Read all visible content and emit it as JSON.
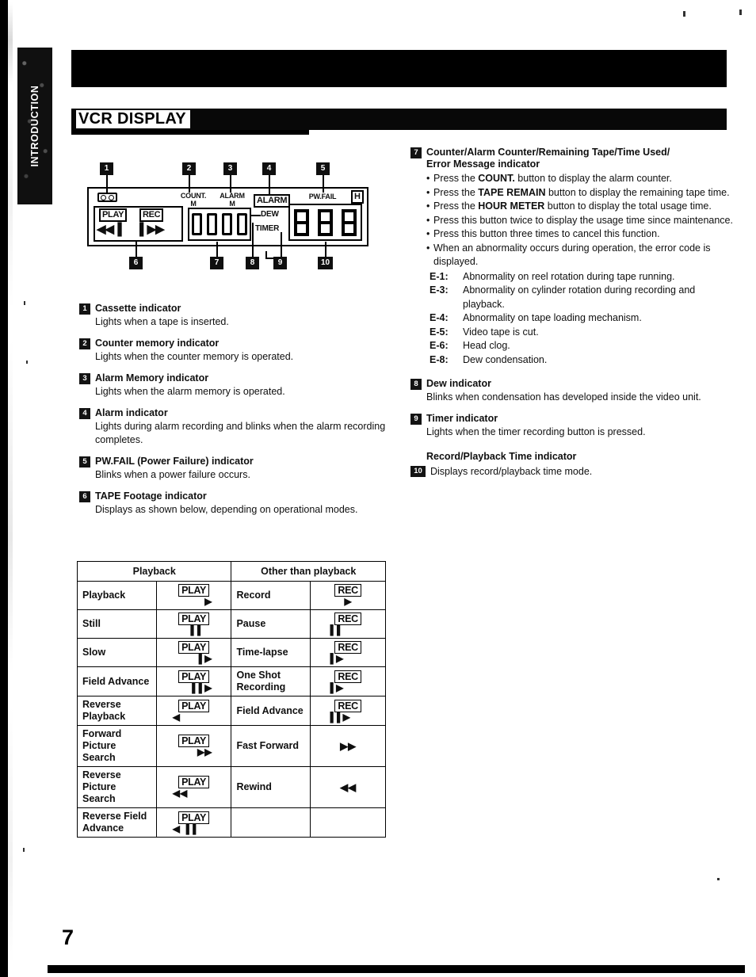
{
  "page": {
    "title": "VCR DISPLAY",
    "section_tab": "INTRODUCTION",
    "number": "7"
  },
  "diagram": {
    "name": "vcr-display-panel",
    "callouts_top": [
      "1",
      "2",
      "3",
      "4",
      "5"
    ],
    "callouts_bottom": [
      "6",
      "7",
      "8",
      "9",
      "10"
    ],
    "labels": {
      "count_m_line1": "COUNT.",
      "count_m_line2": "M",
      "alarm_m_line1": "ALARM",
      "alarm_m_line2": "M",
      "alarm_box": "ALARM",
      "pw_fail": "PW.FAIL",
      "hour": "H",
      "dew": "DEW",
      "timer": "TIMER",
      "play": "PLAY",
      "rec": "REC",
      "play_arrows": "◀◀▐",
      "rec_arrows": "▌▶▶",
      "counter_value": "0000",
      "hour_value": "888",
      "cassette_icon": "cassette-icon"
    }
  },
  "left_column": [
    {
      "num": "1",
      "head": "Cassette indicator",
      "body": "Lights when a tape is inserted."
    },
    {
      "num": "2",
      "head": "Counter memory indicator",
      "body": "Lights when the counter memory is operated."
    },
    {
      "num": "3",
      "head": "Alarm Memory indicator",
      "body": "Lights when the alarm memory is operated."
    },
    {
      "num": "4",
      "head": "Alarm indicator",
      "body": "Lights during alarm recording and blinks when the alarm recording completes."
    },
    {
      "num": "5",
      "head": "PW.FAIL (Power Failure) indicator",
      "body": "Blinks when a power failure occurs."
    },
    {
      "num": "6",
      "head": "TAPE Footage indicator",
      "body": "Displays as shown below, depending on operational modes."
    }
  ],
  "right_column": {
    "item7": {
      "num": "7",
      "head_line1": "Counter/Alarm Counter/Remaining Tape/Time Used/",
      "head_line2": "Error Message indicator",
      "bullets": [
        {
          "pre": "Press the ",
          "strong": "COUNT.",
          "post": " button to display the alarm counter."
        },
        {
          "pre": "Press the ",
          "strong": "TAPE REMAIN",
          "post": " button to display the remaining tape time."
        },
        {
          "pre": "Press the ",
          "strong": "HOUR METER",
          "post": " button to display the total usage time."
        },
        {
          "pre": "Press this button twice to display the usage time since maintenance.",
          "strong": "",
          "post": ""
        },
        {
          "pre": "Press this button three times to cancel this function.",
          "strong": "",
          "post": ""
        },
        {
          "pre": "When an abnormality occurs during operation, the error code is displayed.",
          "strong": "",
          "post": ""
        }
      ],
      "errors": [
        {
          "code": "E-1:",
          "desc": "Abnormality on reel rotation during tape running."
        },
        {
          "code": "E-3:",
          "desc": "Abnormality on cylinder rotation during recording and playback."
        },
        {
          "code": "E-4:",
          "desc": "Abnormality on tape loading mechanism."
        },
        {
          "code": "E-5:",
          "desc": "Video tape is cut."
        },
        {
          "code": "E-6:",
          "desc": "Head clog."
        },
        {
          "code": "E-8:",
          "desc": "Dew condensation."
        }
      ]
    },
    "item8": {
      "num": "8",
      "head": "Dew indicator",
      "body": "Blinks when condensation has developed inside the video unit."
    },
    "item9": {
      "num": "9",
      "head": "Timer indicator",
      "body": "Lights when the timer recording button is pressed."
    },
    "item10": {
      "num": "10",
      "head": "Record/Playback Time indicator",
      "body": "Displays record/playback time mode."
    }
  },
  "mode_table": {
    "headers": [
      "Playback",
      "Other than playback"
    ],
    "rows": [
      {
        "pb_label": "Playback",
        "pb_box": "PLAY",
        "pb_marks": "▶",
        "pb_align": "mk-r",
        "ot_label": "Record",
        "ot_box": "REC",
        "ot_marks": "▶",
        "ot_align": "mk-c"
      },
      {
        "pb_label": "Still",
        "pb_box": "PLAY",
        "pb_marks": "▐▐",
        "pb_align": "mk-c",
        "ot_label": "Pause",
        "ot_box": "REC",
        "ot_marks": "▐▐",
        "ot_align": "mk-l"
      },
      {
        "pb_label": "Slow",
        "pb_box": "PLAY",
        "pb_marks": "▐ ▶",
        "pb_align": "mk-r",
        "ot_label": "Time-lapse",
        "ot_box": "REC",
        "ot_marks": "▐ ▶",
        "ot_align": "mk-l"
      },
      {
        "pb_label": "Field Advance",
        "pb_box": "PLAY",
        "pb_marks": "▐▐ ▶",
        "pb_align": "mk-r",
        "ot_label": "One Shot Recording",
        "ot_box": "REC",
        "ot_marks": "▐ ▶",
        "ot_align": "mk-l"
      },
      {
        "pb_label": "Reverse Playback",
        "pb_box": "PLAY",
        "pb_marks": "◀",
        "pb_align": "mk-l",
        "ot_label": "Field Advance",
        "ot_box": "REC",
        "ot_marks": "▐▐ ▶",
        "ot_align": "mk-l"
      },
      {
        "pb_label": "Forward Picture Search",
        "pb_box": "PLAY",
        "pb_marks": "▶▶",
        "pb_align": "mk-r",
        "ot_label": "Fast Forward",
        "ot_box": "",
        "ot_marks": "▶▶",
        "ot_align": "mk-c"
      },
      {
        "pb_label": "Reverse Picture Search",
        "pb_box": "PLAY",
        "pb_marks": "◀◀",
        "pb_align": "mk-l",
        "ot_label": "Rewind",
        "ot_box": "",
        "ot_marks": "◀◀",
        "ot_align": "mk-c"
      },
      {
        "pb_label": "Reverse Field Advance",
        "pb_box": "PLAY",
        "pb_marks": "◀ ▐▐",
        "pb_align": "mk-l",
        "ot_label": "",
        "ot_box": "",
        "ot_marks": "",
        "ot_align": "mk-c"
      }
    ]
  }
}
